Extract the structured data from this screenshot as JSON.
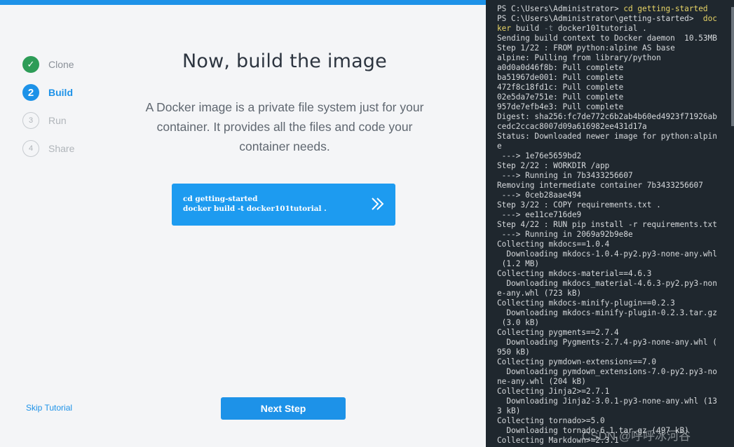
{
  "steps": [
    {
      "num": "✓",
      "label": "Clone",
      "state": "done"
    },
    {
      "num": "2",
      "label": "Build",
      "state": "active"
    },
    {
      "num": "3",
      "label": "Run",
      "state": "todo"
    },
    {
      "num": "4",
      "label": "Share",
      "state": "todo"
    }
  ],
  "main": {
    "title": "Now, build the image",
    "description": "A Docker image is a private file system just for your container. It provides all the files and code your container needs.",
    "command_line1": "cd getting-started",
    "command_line2": "docker build -t docker101tutorial ."
  },
  "footer": {
    "skip_label": "Skip Tutorial",
    "next_label": "Next Step"
  },
  "terminal": {
    "prompt1_prefix": "PS C:\\Users\\Administrator> ",
    "prompt1_cmd": "cd getting-started",
    "prompt2_prefix": "PS C:\\Users\\Administrator\\getting-started>  ",
    "prompt2_cmd_a": "doc",
    "prompt2_cmd_b": "ker",
    "prompt2_build": " build ",
    "prompt2_flag": "-t",
    "prompt2_rest": " docker101tutorial .",
    "lines": [
      "Sending build context to Docker daemon  10.53MB",
      "Step 1/22 : FROM python:alpine AS base",
      "alpine: Pulling from library/python",
      "a0d0a0d46f8b: Pull complete",
      "ba51967de001: Pull complete",
      "472f8c18fd1c: Pull complete",
      "02e5da7e751e: Pull complete",
      "957de7efb4e3: Pull complete",
      "Digest: sha256:fc7de772c6b2ab4b60ed4923f71926ab",
      "cedc2ccac8007d09a616982ee431d17a",
      "Status: Downloaded newer image for python:alpin",
      "e",
      " ---> 1e76e5659bd2",
      "Step 2/22 : WORKDIR /app",
      " ---> Running in 7b3433256607",
      "Removing intermediate container 7b3433256607",
      " ---> 0ceb28aae494",
      "Step 3/22 : COPY requirements.txt .",
      " ---> ee11ce716de9",
      "Step 4/22 : RUN pip install -r requirements.txt",
      " ---> Running in 2069a92b9e8e",
      "Collecting mkdocs==1.0.4",
      "  Downloading mkdocs-1.0.4-py2.py3-none-any.whl",
      " (1.2 MB)",
      "Collecting mkdocs-material==4.6.3",
      "  Downloading mkdocs_material-4.6.3-py2.py3-non",
      "e-any.whl (723 kB)",
      "Collecting mkdocs-minify-plugin==0.2.3",
      "  Downloading mkdocs-minify-plugin-0.2.3.tar.gz",
      " (3.0 kB)",
      "Collecting pygments==2.7.4",
      "  Downloading Pygments-2.7.4-py3-none-any.whl (",
      "950 kB)",
      "Collecting pymdown-extensions==7.0",
      "  Downloading pymdown_extensions-7.0-py2.py3-no",
      "ne-any.whl (204 kB)",
      "Collecting Jinja2>=2.7.1",
      "  Downloading Jinja2-3.0.1-py3-none-any.whl (13",
      "3 kB)",
      "Collecting tornado>=5.0",
      "  Downloading tornado-6.1.tar.gz (497 kB)",
      "Collecting Markdown>=2.3.1"
    ],
    "watermark": "CSDN @呼呼冰河谷"
  }
}
